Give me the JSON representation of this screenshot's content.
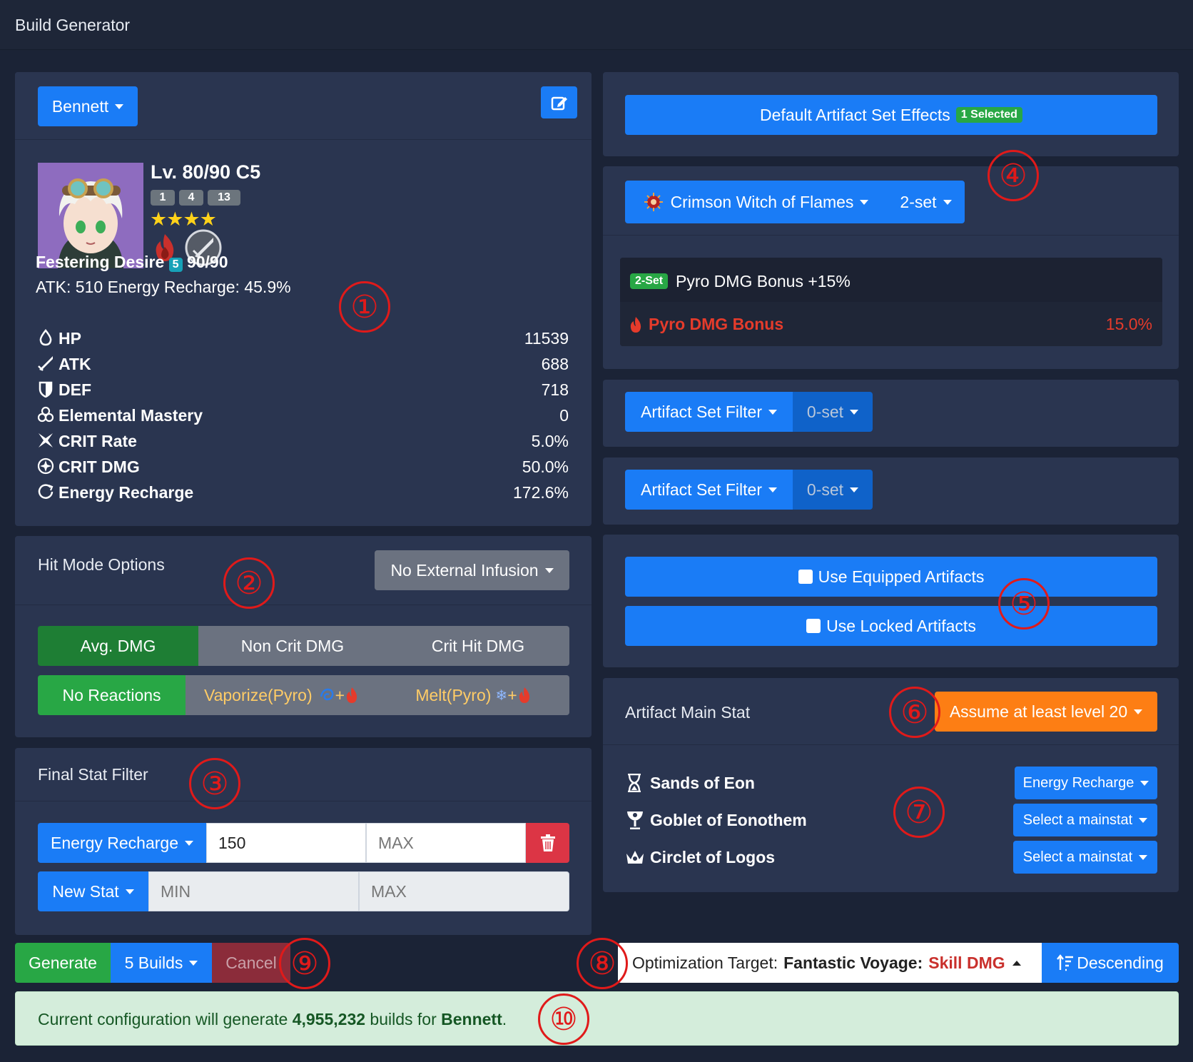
{
  "app": {
    "title": "Build Generator"
  },
  "character": {
    "selector": "Bennett",
    "level": "Lv. 80/90 C5",
    "talents": [
      "1",
      "4",
      "13"
    ],
    "stars": 4,
    "weapon_name": "Festering Desire",
    "weapon_refine": "5",
    "weapon_level": "90/90",
    "weapon_stats": "ATK: 510 Energy Recharge: 45.9%",
    "stats": [
      {
        "icon": "hp-icon",
        "name": "HP",
        "value": "11539"
      },
      {
        "icon": "atk-icon",
        "name": "ATK",
        "value": "688"
      },
      {
        "icon": "def-icon",
        "name": "DEF",
        "value": "718"
      },
      {
        "icon": "elemental-mastery-icon",
        "name": "Elemental Mastery",
        "value": "0"
      },
      {
        "icon": "crit-rate-icon",
        "name": "CRIT Rate",
        "value": "5.0%"
      },
      {
        "icon": "crit-dmg-icon",
        "name": "CRIT DMG",
        "value": "50.0%"
      },
      {
        "icon": "energy-recharge-icon",
        "name": "Energy Recharge",
        "value": "172.6%"
      }
    ]
  },
  "hit_mode": {
    "title": "Hit Mode Options",
    "infusion": "No External Infusion",
    "dmg_modes": [
      "Avg. DMG",
      "Non Crit DMG",
      "Crit Hit DMG"
    ],
    "reactions": [
      "No Reactions",
      "Vaporize(Pyro)",
      "Melt(Pyro)"
    ],
    "plus": "+"
  },
  "final_stat_filter": {
    "title": "Final Stat Filter",
    "row1_stat": "Energy Recharge",
    "row1_min": "150",
    "row1_max_placeholder": "MAX",
    "row2_stat": "New Stat",
    "row2_min_placeholder": "MIN",
    "row2_max_placeholder": "MAX"
  },
  "artifact_sets": {
    "default_effects": "Default Artifact Set Effects",
    "default_badge": "1 Selected",
    "set_name": "Crimson Witch of Flames",
    "set_count": "2-set",
    "effect_badge": "2-Set",
    "effect_text": "Pyro DMG Bonus +15%",
    "bonus_name": "Pyro DMG Bonus",
    "bonus_value": "15.0%",
    "filter1": "Artifact Set Filter",
    "filter1_count": "0-set",
    "filter2": "Artifact Set Filter",
    "filter2_count": "0-set"
  },
  "options": {
    "use_equipped": "Use Equipped Artifacts",
    "use_locked": "Use Locked Artifacts"
  },
  "main_stat": {
    "title": "Artifact Main Stat",
    "level": "Assume at least level 20",
    "slots": [
      {
        "icon": "sands-icon",
        "name": "Sands of Eon",
        "value": "Energy Recharge"
      },
      {
        "icon": "goblet-icon",
        "name": "Goblet of Eonothem",
        "value": "Select a mainstat"
      },
      {
        "icon": "circlet-icon",
        "name": "Circlet of Logos",
        "value": "Select a mainstat"
      }
    ]
  },
  "actions": {
    "generate": "Generate",
    "builds": "5 Builds",
    "cancel": "Cancel",
    "target_label": "Optimization Target:",
    "target_source": "Fantastic Voyage:",
    "target_stat": "Skill DMG",
    "sort": "Descending"
  },
  "summary": {
    "pre": "Current configuration will generate ",
    "count": "4,955,232",
    "mid": " builds for ",
    "name": "Bennett",
    "post": "."
  },
  "annotations": [
    "①",
    "②",
    "③",
    "④",
    "⑤",
    "⑥",
    "⑦",
    "⑧",
    "⑨",
    "⑩"
  ],
  "colors": {
    "blue": "#1a7cf6",
    "green_dark": "#1e7e34",
    "green": "#28a745",
    "red": "#dc3545",
    "orange": "#fd7e14",
    "pyro": "#e53b2b",
    "annotation": "#e01a1a"
  }
}
